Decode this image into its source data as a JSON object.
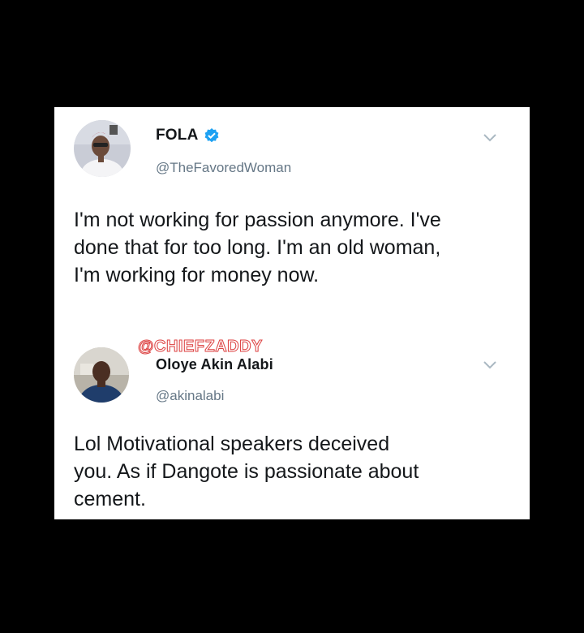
{
  "tweets": [
    {
      "display_name": "FOLA",
      "verified": true,
      "handle": "@TheFavoredWoman",
      "text": "I'm not working for passion anymore. I've\ndone that for too long. I'm an old woman,\nI'm working for money now.",
      "menu_icon": "chevron-down-icon"
    },
    {
      "watermark": "@CHIEFZADDY",
      "display_name": "Oloye Akin Alabi",
      "verified": false,
      "handle": "@akinalabi",
      "text": "Lol   Motivational speakers deceived\nyou. As if Dangote is passionate about\ncement.",
      "menu_icon": "chevron-down-icon"
    }
  ],
  "colors": {
    "verified": "#1da1f2",
    "handle": "#657786",
    "text": "#14171a",
    "watermark_outline": "#d44444"
  }
}
